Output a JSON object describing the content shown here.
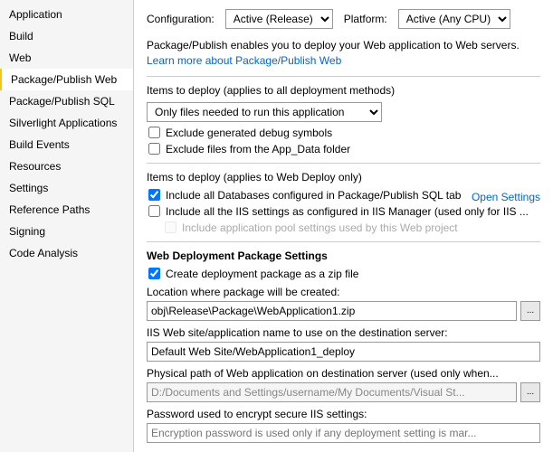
{
  "sidebar": {
    "items": [
      {
        "id": "application",
        "label": "Application",
        "active": false
      },
      {
        "id": "build",
        "label": "Build",
        "active": false
      },
      {
        "id": "web",
        "label": "Web",
        "active": false
      },
      {
        "id": "package-publish-web",
        "label": "Package/Publish Web",
        "active": true
      },
      {
        "id": "package-publish-sql",
        "label": "Package/Publish SQL",
        "active": false
      },
      {
        "id": "silverlight-applications",
        "label": "Silverlight Applications",
        "active": false
      },
      {
        "id": "build-events",
        "label": "Build Events",
        "active": false
      },
      {
        "id": "resources",
        "label": "Resources",
        "active": false
      },
      {
        "id": "settings",
        "label": "Settings",
        "active": false
      },
      {
        "id": "reference-paths",
        "label": "Reference Paths",
        "active": false
      },
      {
        "id": "signing",
        "label": "Signing",
        "active": false
      },
      {
        "id": "code-analysis",
        "label": "Code Analysis",
        "active": false
      }
    ]
  },
  "topbar": {
    "configuration_label": "Configuration:",
    "configuration_value": "Active (Release)",
    "platform_label": "Platform:",
    "platform_value": "Active (Any CPU)"
  },
  "description": {
    "text": "Package/Publish enables you to deploy your Web application to Web servers.",
    "link_text": "Learn more about Package/Publish Web"
  },
  "deploy_section1": {
    "label": "Items to deploy (applies to all deployment methods)",
    "dropdown_value": "Only files needed to run this application",
    "checkbox1_label": "Exclude generated debug symbols",
    "checkbox1_checked": false,
    "checkbox2_label": "Exclude files from the App_Data folder",
    "checkbox2_checked": false
  },
  "deploy_section2": {
    "label": "Items to deploy (applies to Web Deploy only)",
    "checkbox1_label": "Include all Databases configured in Package/Publish SQL tab",
    "checkbox1_checked": true,
    "open_settings": "Open Settings",
    "checkbox2_label": "Include all the IIS settings as configured in IIS Manager (used only for IIS ...",
    "checkbox2_checked": false,
    "checkbox3_label": "Include application pool settings used by this Web project",
    "checkbox3_checked": false,
    "checkbox3_disabled": true
  },
  "web_deploy_section": {
    "label": "Web Deployment Package Settings",
    "checkbox1_label": "Create deployment package as a zip file",
    "checkbox1_checked": true,
    "location_label": "Location where package will be created:",
    "location_value": "obj\\Release\\Package\\WebApplication1.zip",
    "iis_label": "IIS Web site/application name to use on the destination server:",
    "iis_value": "Default Web Site/WebApplication1_deploy",
    "physical_label": "Physical path of Web application on destination server (used only when...",
    "physical_value": "D:/Documents and Settings/username/My Documents/Visual St...",
    "physical_disabled": true,
    "password_label": "Password used to encrypt secure IIS settings:",
    "password_placeholder": "Encryption password is used only if any deployment setting is mar...",
    "browse_label": "..."
  }
}
